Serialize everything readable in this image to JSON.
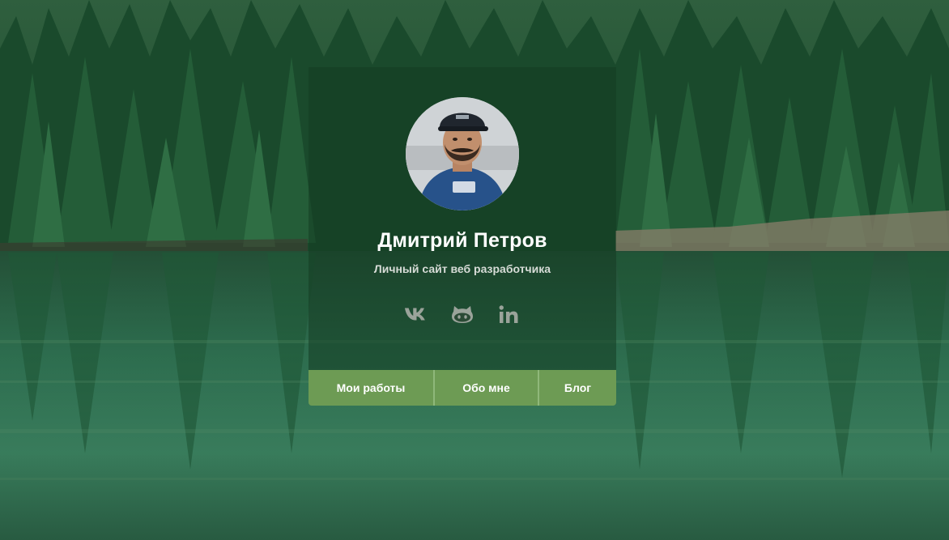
{
  "profile": {
    "name": "Дмитрий Петров",
    "subtitle": "Личный сайт веб разработчика",
    "avatar_alt": "avatar"
  },
  "socials": [
    {
      "icon": "vk-icon"
    },
    {
      "icon": "github-icon"
    },
    {
      "icon": "linkedin-icon"
    }
  ],
  "nav": {
    "items": [
      {
        "label": "Мои работы"
      },
      {
        "label": "Обо мне"
      },
      {
        "label": "Блог"
      }
    ]
  },
  "colors": {
    "accent": "#6d9b54",
    "icons": "#9aa39a",
    "card_overlay": "rgba(20,60,35,0.55)"
  }
}
